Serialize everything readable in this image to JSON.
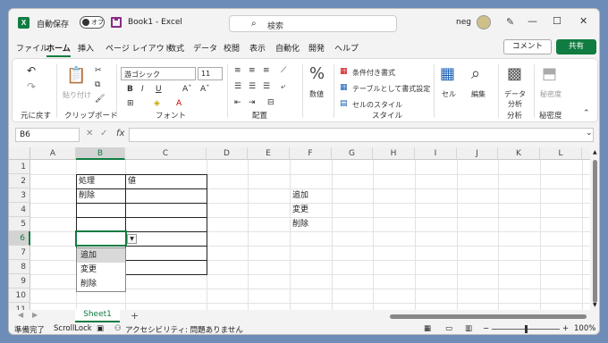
{
  "titlebar": {
    "app_icon": "X",
    "autosave_label": "自動保存",
    "toggle_label": "オフ",
    "title": "Book1 - Excel",
    "search_placeholder": "検索",
    "user": "neg",
    "minimize": "—",
    "maximize": "☐",
    "close": "✕"
  },
  "menu": {
    "items": [
      "ファイル",
      "ホーム",
      "挿入",
      "ページ レイアウト",
      "数式",
      "データ",
      "校閲",
      "表示",
      "自動化",
      "開発",
      "ヘルプ"
    ],
    "active": "ホーム",
    "comment_button": "コメント",
    "share_button": "共有"
  },
  "ribbon": {
    "font_name": "游ゴシック",
    "font_size": "11",
    "paste_label": "貼り付け",
    "number_format_label": "数値",
    "conditional_format": "条件付き書式",
    "format_as_table": "テーブルとして書式設定",
    "cell_styles": "セルのスタイル",
    "cells_label": "セル",
    "editing_label": "編集",
    "data_analysis_label": "データ分析",
    "sensitivity_label": "秘密度",
    "groups": [
      "元に戻す",
      "クリップボード",
      "フォント",
      "配置",
      "数値",
      "スタイル",
      "分析",
      "秘密度"
    ]
  },
  "formula_bar": {
    "name_box": "B6",
    "fx": "fx",
    "content": ""
  },
  "grid": {
    "columns": [
      "A",
      "B",
      "C",
      "D",
      "E",
      "F",
      "G",
      "H",
      "I",
      "J",
      "K",
      "L"
    ],
    "rows": [
      "1",
      "2",
      "3",
      "4",
      "5",
      "6",
      "7",
      "8",
      "9",
      "10",
      "11"
    ],
    "selected_column": "B",
    "selected_row": "6",
    "cells": {
      "B2": "処理",
      "C2": "値",
      "B3": "削除",
      "F3": "追加",
      "F4": "変更",
      "F5": "削除"
    },
    "dropdown_items": [
      "追加",
      "変更",
      "削除"
    ],
    "dropdown_highlight": "追加"
  },
  "sheets": {
    "tabs": [
      "Sheet1"
    ],
    "add_label": "+"
  },
  "status": {
    "ready": "準備完了",
    "scroll_lock": "ScrollLock",
    "accessibility": "アクセシビリティ: 問題ありません",
    "zoom": "100%"
  }
}
